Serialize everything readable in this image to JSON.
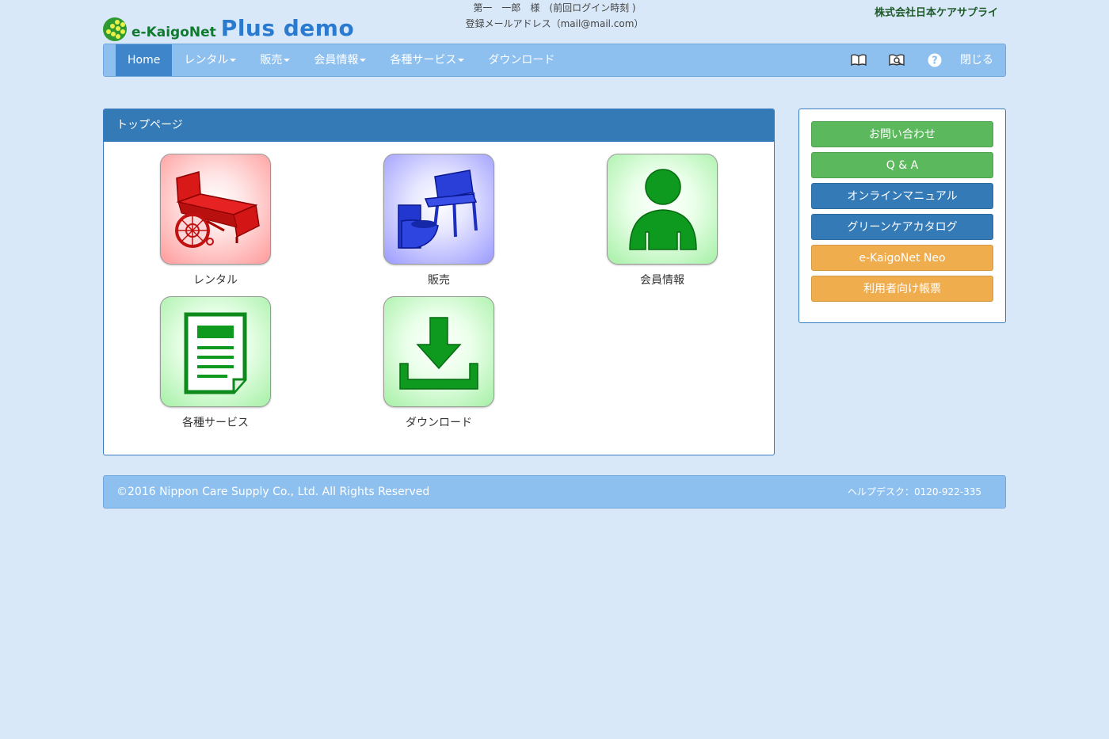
{
  "header": {
    "logo_word": "e-KaigoNet",
    "logo_plus": "Plus demo",
    "user_line": "第一　一郎　様　(前回ログイン時刻 )",
    "mail_line": "登録メールアドレス（mail@mail.com）",
    "company": "株式会社日本ケアサプライ"
  },
  "nav": {
    "home": "Home",
    "rental": "レンタル",
    "sales": "販売",
    "member": "会員情報",
    "services": "各種サービス",
    "download": "ダウンロード",
    "close": "閉じる",
    "icons": [
      "book-icon",
      "book-search-icon",
      "help-icon"
    ]
  },
  "main": {
    "title": "トップページ",
    "tiles": [
      {
        "label": "レンタル",
        "icon": "bed-wheelchair-icon"
      },
      {
        "label": "販売",
        "icon": "chair-toilet-icon"
      },
      {
        "label": "会員情報",
        "icon": "person-icon"
      },
      {
        "label": "各種サービス",
        "icon": "document-icon"
      },
      {
        "label": "ダウンロード",
        "icon": "download-icon"
      }
    ]
  },
  "side": {
    "contact": "お問い合わせ",
    "qa": "Q & A",
    "manual": "オンラインマニュアル",
    "catalog": "グリーンケアカタログ",
    "neo": "e-KaigoNet Neo",
    "forms": "利用者向け帳票"
  },
  "footer": {
    "copyright": "©2016 Nippon Care Supply Co., Ltd. All Rights Reserved",
    "helpdesk": "ヘルプデスク：0120-922-335"
  },
  "colors": {
    "background": "#d9e8f8",
    "nav": "#8ec0ef",
    "nav_active": "#3f85c9",
    "panel_head": "#337ab7",
    "btn_green": "#5cb85c",
    "btn_blue": "#337ab7",
    "btn_orange": "#f0ad4e"
  }
}
